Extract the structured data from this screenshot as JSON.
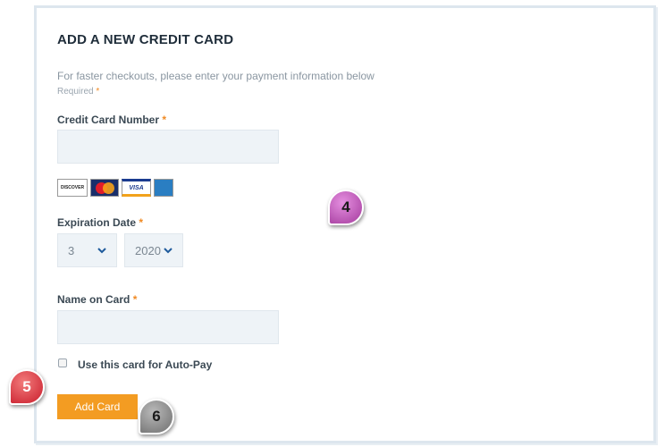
{
  "form": {
    "title": "ADD A NEW CREDIT CARD",
    "subtitle": "For faster checkouts, please enter your payment information below",
    "required_note": "Required",
    "required_marker": "*",
    "card_number_label": "Credit Card Number",
    "card_number_value": "",
    "accepted_cards": [
      "DISCOVER",
      "MasterCard",
      "VISA",
      "AMERICAN EXPRESS"
    ],
    "expiration_label": "Expiration Date",
    "exp_month": "3",
    "exp_year": "2020",
    "name_label": "Name on Card",
    "name_value": "",
    "autopay_label": "Use this card for Auto-Pay",
    "autopay_checked": false,
    "submit_label": "Add Card"
  },
  "callouts": {
    "b4": "4",
    "b5": "5",
    "b6": "6"
  },
  "colors": {
    "accent": "#f39c22",
    "required_star": "#f08a24",
    "field_bg": "#eef3f7"
  }
}
